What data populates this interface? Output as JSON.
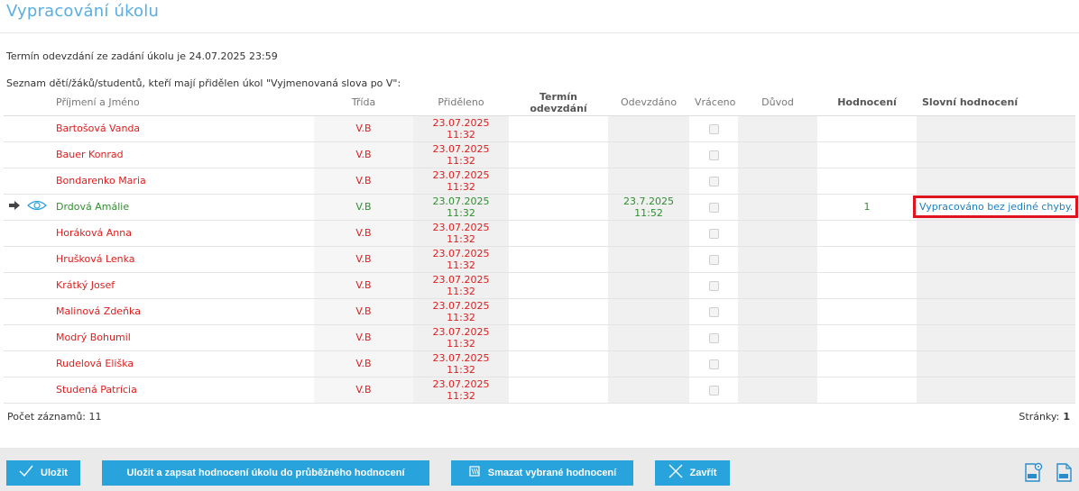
{
  "page": {
    "title": "Vypracování úkolu",
    "deadline_text": "Termín odevzdání ze zadání úkolu je 24.07.2025 23:59",
    "list_label": "Seznam dětí/žáků/studentů, kteří mají přidělen úkol \"Vyjmenovaná slova po V\":"
  },
  "table": {
    "headers": {
      "name": "Příjmení a Jméno",
      "class": "Třída",
      "assigned": "Přiděleno",
      "deadline": "Termín odevzdání",
      "submitted": "Odevzdáno",
      "returned": "Vráceno",
      "reason": "Důvod",
      "grade": "Hodnocení",
      "verbal": "Slovní hodnocení"
    },
    "rows": [
      {
        "name": "Bartošová Vanda",
        "class": "V.B",
        "assigned": "23.07.2025 11:32",
        "submitted": "",
        "grade": "",
        "verbal": "",
        "status": "red"
      },
      {
        "name": "Bauer Konrad",
        "class": "V.B",
        "assigned": "23.07.2025 11:32",
        "submitted": "",
        "grade": "",
        "verbal": "",
        "status": "red"
      },
      {
        "name": "Bondarenko Maria",
        "class": "V.B",
        "assigned": "23.07.2025 11:32",
        "submitted": "",
        "grade": "",
        "verbal": "",
        "status": "red"
      },
      {
        "name": "Drdová Amálie",
        "class": "V.B",
        "assigned": "23.07.2025 11:32",
        "submitted": "23.7.2025 11:52",
        "grade": "1",
        "verbal": "Vypracováno bez jediné chyby.",
        "status": "green",
        "selected": true
      },
      {
        "name": "Horáková Anna",
        "class": "V.B",
        "assigned": "23.07.2025 11:32",
        "submitted": "",
        "grade": "",
        "verbal": "",
        "status": "red"
      },
      {
        "name": "Hrušková Lenka",
        "class": "V.B",
        "assigned": "23.07.2025 11:32",
        "submitted": "",
        "grade": "",
        "verbal": "",
        "status": "red"
      },
      {
        "name": "Krátký Josef",
        "class": "V.B",
        "assigned": "23.07.2025 11:32",
        "submitted": "",
        "grade": "",
        "verbal": "",
        "status": "red"
      },
      {
        "name": "Malinová Zdeňka",
        "class": "V.B",
        "assigned": "23.07.2025 11:32",
        "submitted": "",
        "grade": "",
        "verbal": "",
        "status": "red"
      },
      {
        "name": "Modrý Bohumil",
        "class": "V.B",
        "assigned": "23.07.2025 11:32",
        "submitted": "",
        "grade": "",
        "verbal": "",
        "status": "red"
      },
      {
        "name": "Rudelová Eliška",
        "class": "V.B",
        "assigned": "23.07.2025 11:32",
        "submitted": "",
        "grade": "",
        "verbal": "",
        "status": "red"
      },
      {
        "name": "Studená Patrícia",
        "class": "V.B",
        "assigned": "23.07.2025 11:32",
        "submitted": "",
        "grade": "",
        "verbal": "",
        "status": "red"
      }
    ]
  },
  "footer": {
    "count_label": "Počet záznamů: 11",
    "pages_label": "Stránky:",
    "current_page": "1"
  },
  "buttons": {
    "save": "Uložit",
    "save_and_record": "Uložit a zapsat hodnocení úkolu do průběžného hodnocení",
    "delete_selected": "Smazat vybrané hodnocení",
    "close": "Zavřít"
  },
  "icons": {
    "row_arrow": "arrow-right-icon",
    "eye": "eye-icon",
    "save": "checkmark-icon",
    "delete": "eraser-icon",
    "close": "x-icon",
    "export_settings": "xls-settings-icon",
    "export_xls": "xls-icon"
  },
  "colors": {
    "accent": "#29a3dc",
    "title": "#5aaee0",
    "not_submitted": "#dc1e1e",
    "submitted": "#2f8f2f",
    "highlight_border": "#e0141e"
  }
}
